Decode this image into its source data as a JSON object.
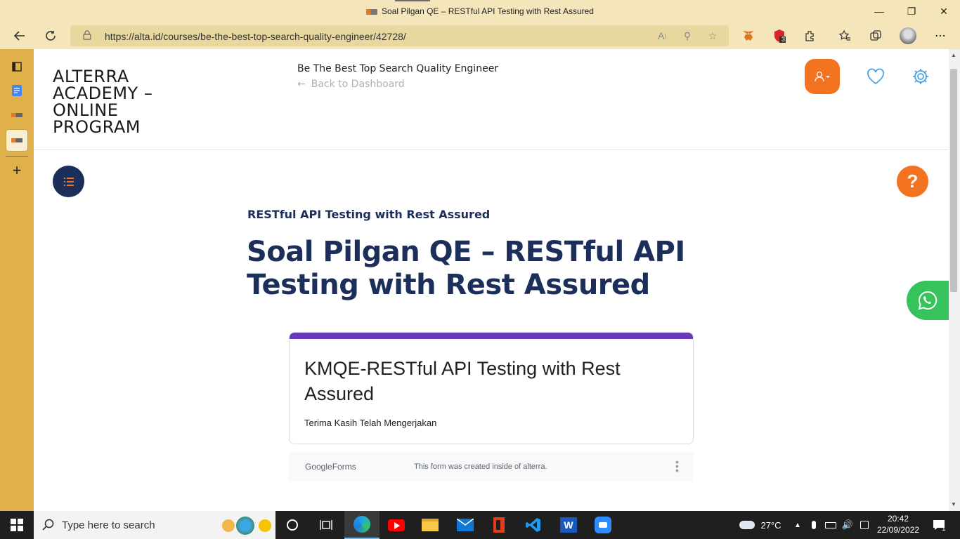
{
  "browser": {
    "window_title": "Soal Pilgan QE – RESTful API Testing with Rest Assured",
    "url": "https://alta.id/courses/be-the-best-top-search-quality-engineer/42728/",
    "extension_badge": "3"
  },
  "header": {
    "brand": "ALTERRA ACADEMY – ONLINE PROGRAM",
    "course_title": "Be The Best Top Search Quality Engineer",
    "back_link": "Back to Dashboard"
  },
  "lesson": {
    "subtitle": "RESTful API Testing with Rest Assured",
    "title": "Soal Pilgan QE – RESTful API Testing with Rest Assured"
  },
  "form": {
    "title": "KMQE-RESTful API Testing with Rest Assured",
    "message": "Terima Kasih Telah Mengerjakan",
    "footer_brand_google": "Google",
    "footer_brand_forms": "Forms",
    "footer_note": "This form was created inside of alterra."
  },
  "help_label": "?",
  "taskbar": {
    "search_placeholder": "Type here to search",
    "weather": "27°C",
    "time": "20:42",
    "date": "22/09/2022",
    "notification_count": "1"
  },
  "colors": {
    "navy": "#1c2f5b",
    "orange": "#f37321",
    "forms_purple": "#673ab7",
    "whatsapp_green": "#36c35b"
  }
}
